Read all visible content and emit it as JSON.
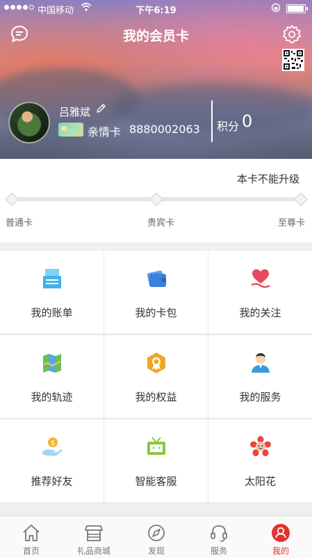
{
  "status_bar": {
    "carrier": "中国移动",
    "time": "下午6:19",
    "battery_level": 0.95
  },
  "header": {
    "title": "我的会员卡",
    "left_icon": "chat-bubble-icon",
    "right_icon": "gear-icon",
    "qr_icon": "qr-code-icon"
  },
  "member": {
    "name": "吕雅斌",
    "card_type": "亲情卡",
    "card_number": "8880002063",
    "points_label": "积分",
    "points_value": "0"
  },
  "level": {
    "upgrade_note": "本卡不能升级",
    "levels": [
      "普通卡",
      "贵宾卡",
      "至尊卡"
    ]
  },
  "grid": {
    "items": [
      {
        "label": "我的账单",
        "icon": "bill-icon",
        "color": "#3fb3e8"
      },
      {
        "label": "我的卡包",
        "icon": "wallet-icon",
        "color": "#3e7fd8"
      },
      {
        "label": "我的关注",
        "icon": "heart-icon",
        "color": "#e84a5f"
      },
      {
        "label": "我的轨迹",
        "icon": "map-icon",
        "color": "#6bbf5a"
      },
      {
        "label": "我的权益",
        "icon": "award-badge-icon",
        "color": "#f2a623"
      },
      {
        "label": "我的服务",
        "icon": "person-service-icon",
        "color": "#3b9bdc"
      },
      {
        "label": "推荐好友",
        "icon": "hand-coin-icon",
        "color": "#f2b62a"
      },
      {
        "label": "智能客服",
        "icon": "tv-icon",
        "color": "#8dc63f"
      },
      {
        "label": "太阳花",
        "icon": "sunflower-icon",
        "color": "#e8453c"
      }
    ]
  },
  "tabbar": {
    "tabs": [
      {
        "label": "首页",
        "icon": "home-icon"
      },
      {
        "label": "礼品商城",
        "icon": "store-icon"
      },
      {
        "label": "发现",
        "icon": "compass-icon"
      },
      {
        "label": "服务",
        "icon": "headset-icon"
      },
      {
        "label": "我的",
        "icon": "profile-icon"
      }
    ],
    "active_index": 4,
    "active_color": "#e5322d"
  }
}
